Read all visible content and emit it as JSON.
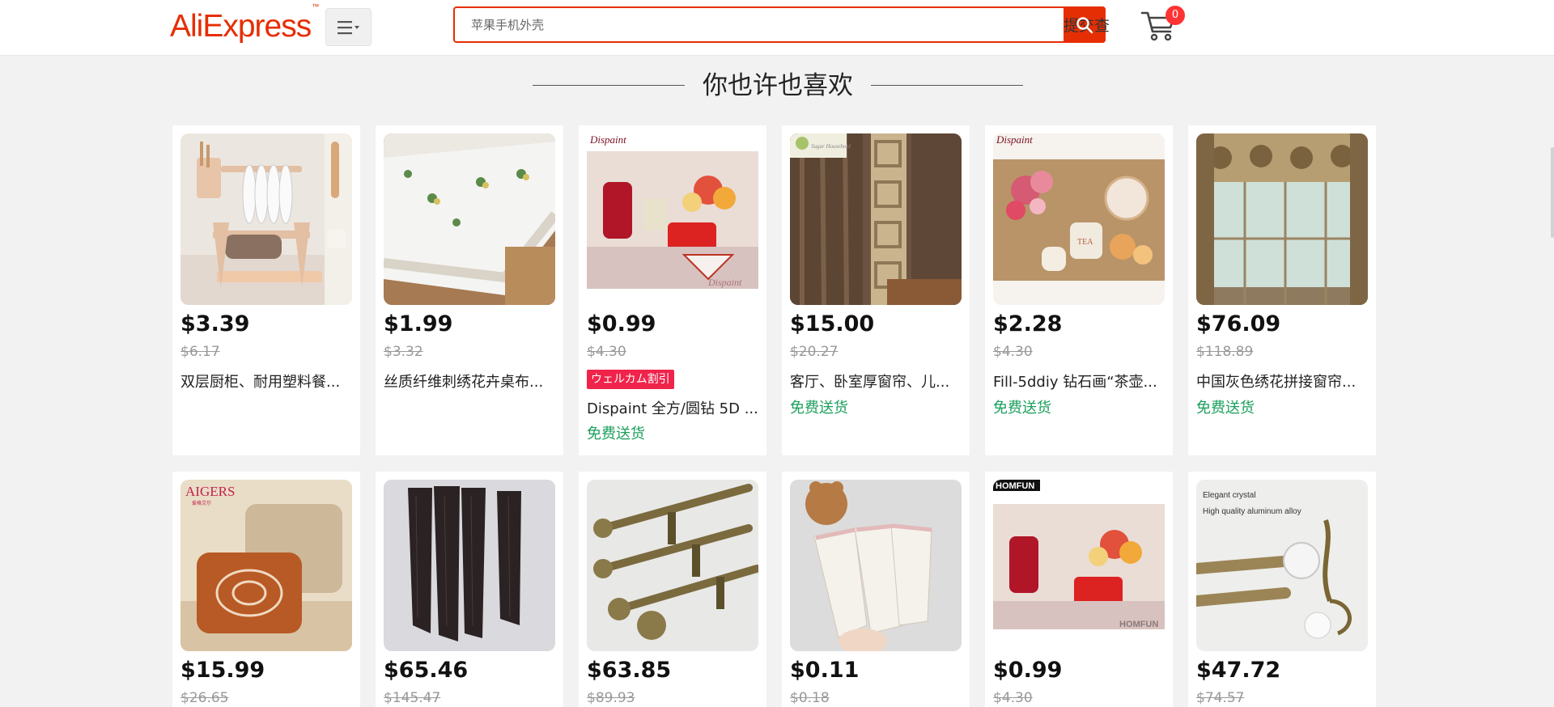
{
  "header": {
    "logo": "AliExpress",
    "search": {
      "placeholder": "苹果手机外壳",
      "button_label": "提交查"
    },
    "cart_count": "0"
  },
  "section": {
    "title": "你也许也喜欢"
  },
  "products_row1": [
    {
      "price": "$3.39",
      "old_price": "$6.17",
      "title": "双层厨柜、耐用塑料餐...",
      "badge": "",
      "shipping": ""
    },
    {
      "price": "$1.99",
      "old_price": "$3.32",
      "title": "丝质纤维刺绣花卉桌布...",
      "badge": "",
      "shipping": ""
    },
    {
      "price": "$0.99",
      "old_price": "$4.30",
      "badge": "ウェルカム割引",
      "title": "Dispaint 全方/圆钻 5D ...",
      "shipping": "免费送货"
    },
    {
      "price": "$15.00",
      "old_price": "$20.27",
      "title": "客厅、卧室厚窗帘、儿...",
      "badge": "",
      "shipping": "免费送货"
    },
    {
      "price": "$2.28",
      "old_price": "$4.30",
      "title": "Fill-5ddiy 钻石画“茶壶...",
      "badge": "",
      "shipping": "免费送货"
    },
    {
      "price": "$76.09",
      "old_price": "$118.89",
      "title": "中国灰色绣花拼接窗帘...",
      "badge": "",
      "shipping": "免费送货"
    }
  ],
  "products_row2": [
    {
      "price": "$15.99",
      "old_price": "$26.65"
    },
    {
      "price": "$65.46",
      "old_price": "$145.47"
    },
    {
      "price": "$63.85",
      "old_price": "$89.93"
    },
    {
      "price": "$0.11",
      "old_price": "$0.18"
    },
    {
      "price": "$0.99",
      "old_price": "$4.30"
    },
    {
      "price": "$47.72",
      "old_price": "$74.57"
    }
  ],
  "image_captions": {
    "dispaint": "Dispaint",
    "homfun": "HOMFUN",
    "aigers": "AIGERS",
    "aigers_sub": "爱格艾尔",
    "crystal_line1": "Elegant crystal",
    "crystal_line2": "High quality aluminum alloy",
    "tea": "TEA",
    "sugar": "Sugar Household"
  },
  "colors": {
    "accent": "#e62e04",
    "shipping": "#1a9f5c",
    "badge": "#f0234b"
  }
}
